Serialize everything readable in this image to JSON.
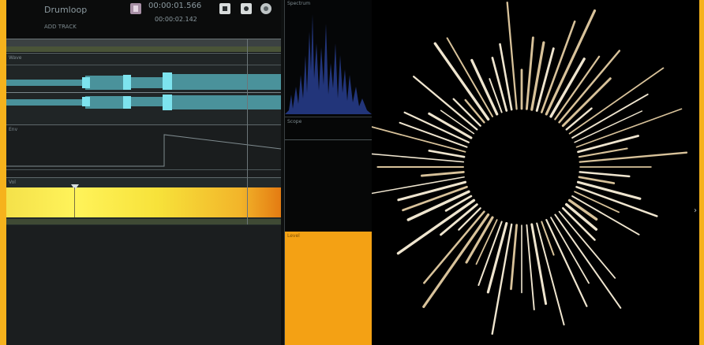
{
  "header": {
    "title": "Drumloop",
    "subtitle": "ADD TRACK",
    "time_main": "00:00:01.566",
    "time_sub": "00:00:02.142"
  },
  "toolbar": {
    "record_icon": "record-icon",
    "buttons": [
      "stop-icon",
      "record-icon",
      "gear-icon"
    ]
  },
  "tracks": [
    {
      "id": "track1",
      "label": "Wave"
    },
    {
      "id": "track2",
      "label": "Env"
    },
    {
      "id": "track3",
      "label": "Vol"
    }
  ],
  "panels": {
    "spectrum_label": "Spectrum",
    "scope_label": "Scope",
    "level_label": "Level"
  },
  "colors": {
    "accent": "#f6b21c",
    "wave": "#57c7d3",
    "spectrum": "#22357a",
    "level": "#f4a114"
  }
}
